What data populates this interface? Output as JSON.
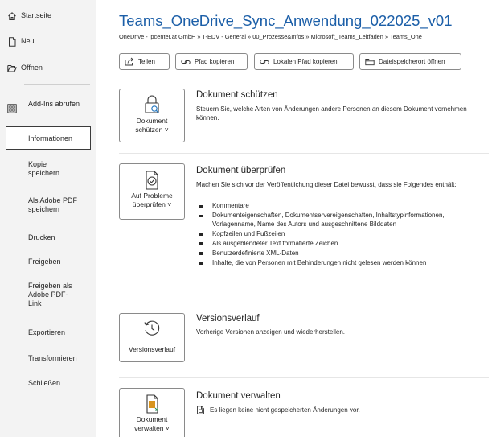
{
  "sidebar": {
    "items": [
      {
        "label": "Startseite",
        "icon": "home-icon"
      },
      {
        "label": "Neu",
        "icon": "new-document-icon"
      },
      {
        "label": "Öffnen",
        "icon": "open-folder-icon"
      },
      {
        "label": "Add-Ins abrufen",
        "icon": "add-ins-icon"
      },
      {
        "label": "Informationen",
        "active": true
      },
      {
        "label": "Kopie speichern"
      },
      {
        "label": "Als Adobe PDF speichern"
      },
      {
        "label": "Drucken"
      },
      {
        "label": "Freigeben"
      },
      {
        "label": "Freigeben als Adobe PDF-Link"
      },
      {
        "label": "Exportieren"
      },
      {
        "label": "Transformieren"
      },
      {
        "label": "Schließen"
      }
    ]
  },
  "header": {
    "title": "Teams_OneDrive_Sync_Anwendung_022025_v01",
    "path": "OneDrive - ipcenter.at GmbH » T-EDV - General » 00_Prozesse&Infos » Microsoft_Teams_Leitfaden » Teams_One"
  },
  "path_buttons": [
    {
      "label": "Teilen",
      "icon": "share-icon"
    },
    {
      "label": "Pfad kopieren",
      "icon": "link-icon"
    },
    {
      "label": "Lokalen Pfad kopieren",
      "icon": "link-icon"
    },
    {
      "label": "Dateispeicherort öffnen",
      "icon": "folder-icon"
    }
  ],
  "sections": {
    "protect": {
      "button_line1": "Dokument",
      "button_line2": "schützen ˅",
      "heading": "Dokument schützen",
      "text": "Steuern Sie, welche Arten von Änderungen andere Personen an diesem Dokument vornehmen können."
    },
    "inspect": {
      "button_line1": "Auf Probleme",
      "button_line2": "überprüfen ˅",
      "heading": "Dokument überprüfen",
      "text": "Machen Sie sich vor der Veröffentlichung dieser Datei bewusst, dass sie Folgendes enthält:",
      "bullets": [
        "Kommentare",
        "Dokumenteigenschaften, Dokumentservereigenschaften, Inhaltstypinformationen, Vorlagenname, Name des Autors und ausgeschnittene Bilddaten",
        "Kopfzeilen und Fußzeilen",
        "Als ausgeblendeter Text formatierte Zeichen",
        "Benutzerdefinierte XML-Daten",
        "Inhalte, die von Personen mit Behinderungen nicht gelesen werden können"
      ]
    },
    "versions": {
      "button_line1": "Versionsverlauf",
      "heading": "Versionsverlauf",
      "text": "Vorherige Versionen anzeigen und wiederherstellen."
    },
    "manage": {
      "button_line1": "Dokument",
      "button_line2": "verwalten ˅",
      "heading": "Dokument verwalten",
      "text": "Es liegen keine nicht gespeicherten Änderungen vor."
    }
  },
  "colors": {
    "title": "#1c5fa8",
    "sidebar_bg": "#f3f3f3",
    "accent_orange": "#d8941e",
    "accent_blue": "#2b7bc2"
  }
}
